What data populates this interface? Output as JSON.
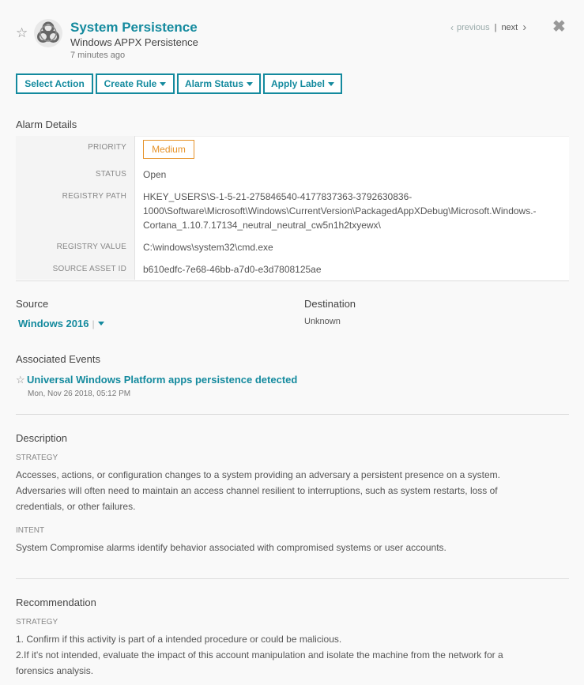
{
  "header": {
    "title": "System Persistence",
    "subtitle": "Windows APPX Persistence",
    "time_ago": "7 minutes ago",
    "nav_previous": "previous",
    "nav_next": "next"
  },
  "actions": {
    "select_action": "Select Action",
    "create_rule": "Create Rule",
    "alarm_status": "Alarm Status",
    "apply_label": "Apply Label"
  },
  "alarm_details": {
    "heading": "Alarm Details",
    "priority_label": "PRIORITY",
    "priority_value": "Medium",
    "status_label": "STATUS",
    "status_value": "Open",
    "registry_path_label": "REGISTRY PATH",
    "registry_path_line1": "HKEY_USERS\\S-1-5-21-275846540-4177837363-3792630836-",
    "registry_path_line2": "1000\\Software\\Microsoft\\Windows\\CurrentVersion\\PackagedAppXDebug\\Microsoft.Windows.-",
    "registry_path_line3": "Cortana_1.10.7.17134_neutral_neutral_cw5n1h2txyewx\\",
    "registry_value_label": "REGISTRY VALUE",
    "registry_value": "C:\\windows\\system32\\cmd.exe",
    "source_asset_label": "SOURCE ASSET ID",
    "source_asset_value": "b610edfc-7e68-46bb-a7d0-e3d7808125ae"
  },
  "source": {
    "heading": "Source",
    "value": "Windows 2016"
  },
  "destination": {
    "heading": "Destination",
    "value": "Unknown"
  },
  "events": {
    "heading": "Associated Events",
    "event_title": "Universal Windows Platform apps persistence detected",
    "event_time": "Mon, Nov 26 2018, 05:12 PM"
  },
  "description": {
    "heading": "Description",
    "strategy_label": "STRATEGY",
    "strategy_line1": "Accesses, actions, or configuration changes to a system providing an adversary a persistent presence on a system.",
    "strategy_line2": "Adversaries will often need to maintain an access channel resilient to interruptions, such as system restarts, loss of",
    "strategy_line3": "credentials, or other failures.",
    "intent_label": "INTENT",
    "intent_text": "System Compromise alarms identify behavior associated with compromised systems or user accounts."
  },
  "recommendation": {
    "heading": "Recommendation",
    "strategy_label": "STRATEGY",
    "line1": "1. Confirm if this activity is part of a intended procedure or could be malicious.",
    "line2": "2.If it's not intended, evaluate the impact of this account manipulation and isolate the machine from the network for a",
    "line3": "forensics analysis."
  },
  "icons": {
    "favorite": "star-outline-icon",
    "alarm": "biohazard-icon",
    "close": "close-x-icon",
    "prev": "chevron-left-icon",
    "next": "chevron-right-icon"
  },
  "colors": {
    "accent": "#148a9e",
    "priority_medium": "#e6932a"
  }
}
